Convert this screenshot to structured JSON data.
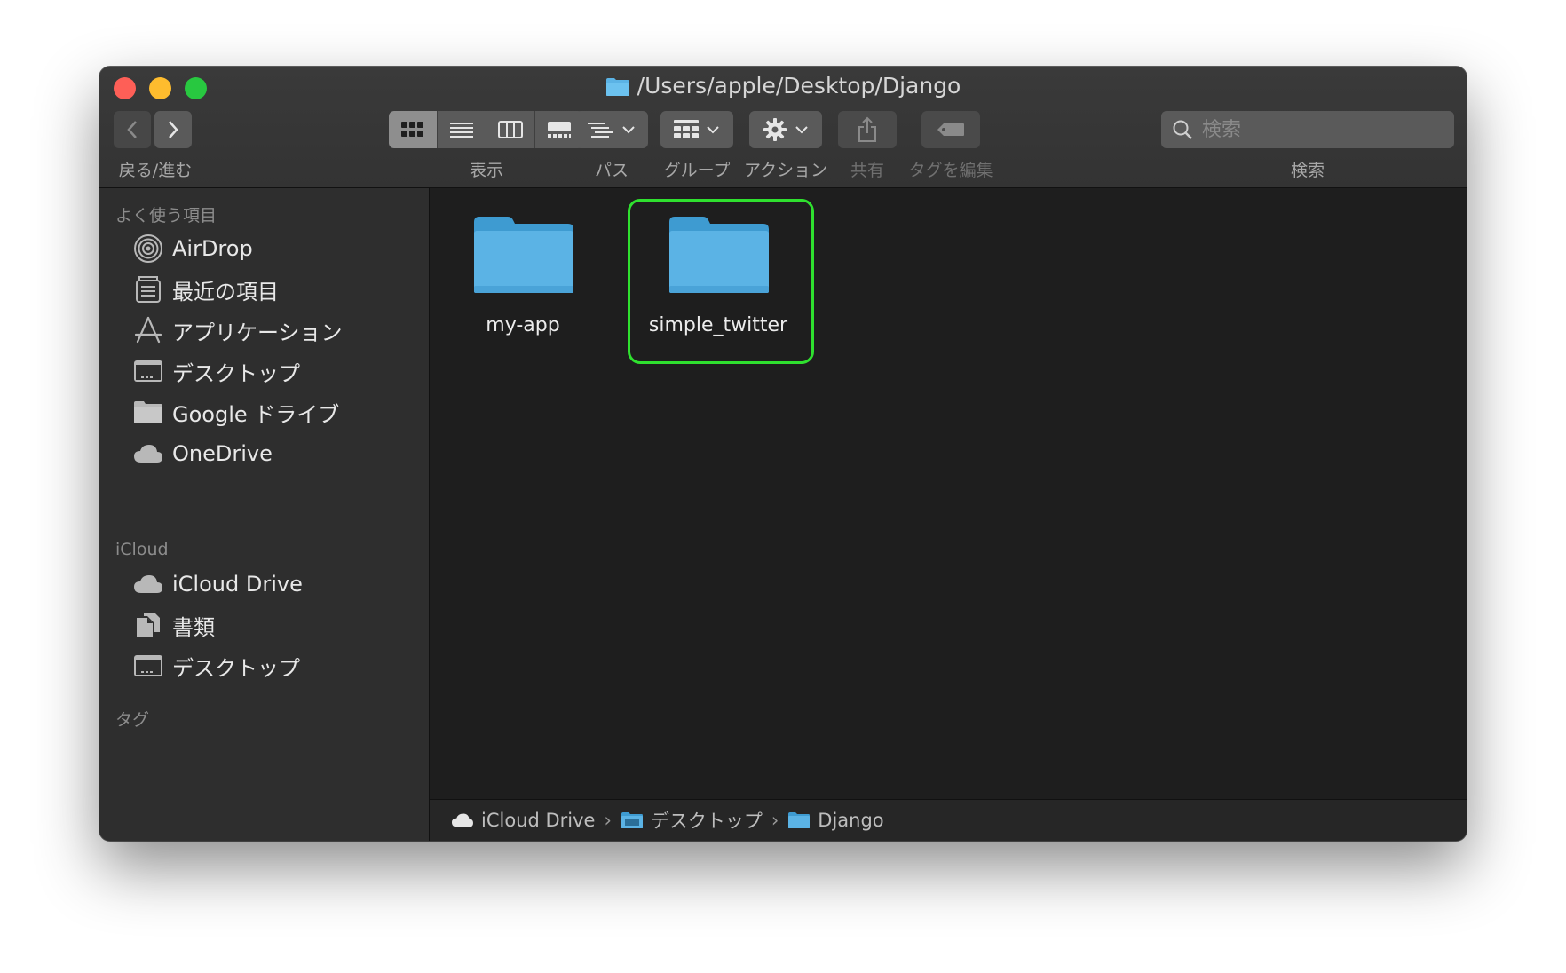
{
  "window": {
    "title": "/Users/apple/Desktop/Django"
  },
  "toolbar": {
    "nav_label": "戻る/進む",
    "view_label": "表示",
    "path_label": "パス",
    "group_label": "グループ",
    "action_label": "アクション",
    "share_label": "共有",
    "tags_label": "タグを編集",
    "search_label": "検索",
    "search_placeholder": "検索",
    "active_view": "icon"
  },
  "sidebar": {
    "favorites_header": "よく使う項目",
    "favorites": [
      {
        "label": "AirDrop",
        "icon": "airdrop-icon"
      },
      {
        "label": "最近の項目",
        "icon": "recents-icon"
      },
      {
        "label": "アプリケーション",
        "icon": "applications-icon"
      },
      {
        "label": "デスクトップ",
        "icon": "desktop-icon"
      },
      {
        "label": "Google ドライブ",
        "icon": "folder-icon"
      },
      {
        "label": "OneDrive",
        "icon": "cloud-icon"
      }
    ],
    "icloud_header": "iCloud",
    "icloud": [
      {
        "label": "iCloud Drive",
        "icon": "cloud-icon"
      },
      {
        "label": "書類",
        "icon": "documents-icon"
      },
      {
        "label": "デスクトップ",
        "icon": "desktop-icon"
      }
    ],
    "tags_header": "タグ"
  },
  "files": [
    {
      "name": "my-app",
      "selected": false
    },
    {
      "name": "simple_twitter",
      "selected": true
    }
  ],
  "pathbar": [
    "iCloud Drive",
    "デスクトップ",
    "Django"
  ],
  "colors": {
    "folder": "#5bb3e5",
    "highlight": "#2fe02f"
  }
}
